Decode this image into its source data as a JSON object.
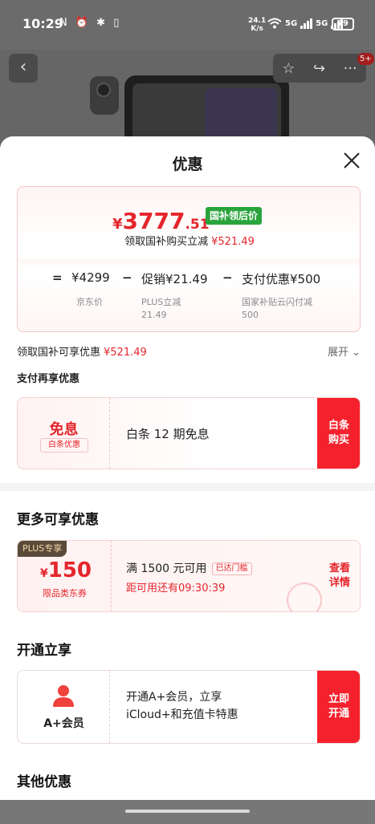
{
  "status_bar": {
    "time": "10:29",
    "left_icons": "N ⏰ ✱ ▯",
    "net_speed_value": "24.1",
    "net_speed_unit": "K/s",
    "sig1": "5G",
    "sig2": "5G",
    "battery": "79"
  },
  "product_header": {
    "cart_badge": "5+"
  },
  "sheet": {
    "title": "优惠",
    "price_card": {
      "currency": "¥",
      "price_int": "3777",
      "price_dec": ".51",
      "tag": "国补领后价",
      "subsidy_text": "领取国补购买立减",
      "subsidy_amount": "¥521.49",
      "formula": {
        "eq": "=",
        "jd_price": "¥4299",
        "minus1": "−",
        "promo_value": "促销¥21.49",
        "minus2": "−",
        "pay_value": "支付优惠¥500",
        "jd_price_label": "京东价",
        "promo_label_1": "PLUS立减",
        "promo_label_2": "21.49",
        "pay_label_1": "国家补贴云闪付减",
        "pay_label_2": "500"
      }
    },
    "subsidy_row": {
      "text": "领取国补可享优惠",
      "amount": "¥521.49",
      "expand": "展开"
    },
    "pay_section": {
      "title": "支付再享优惠",
      "coupon_title": "免息",
      "coupon_sub": "白条优惠",
      "desc": "白条 12 期免息",
      "btn_line1": "白条",
      "btn_line2": "购买"
    },
    "more_section": {
      "title": "更多可享优惠",
      "plus_tag": "PLUS专享",
      "currency": "¥",
      "value": "150",
      "coupon_sub": "限品类东券",
      "condition": "满 1500 元可用",
      "status": "已达门槛",
      "countdown": "距可用还有09:30:39",
      "btn_line1": "查看",
      "btn_line2": "详情"
    },
    "vip_section": {
      "title": "开通立享",
      "label": "A+会员",
      "desc_line1": "开通A+会员，立享",
      "desc_line2": "iCloud+和充值卡特惠",
      "btn_line1": "立即",
      "btn_line2": "开通"
    },
    "other_section": {
      "title": "其他优惠"
    }
  },
  "colors": {
    "accent": "#f5222d",
    "price_red": "#e4262c",
    "tag_green": "#2aa43c"
  }
}
